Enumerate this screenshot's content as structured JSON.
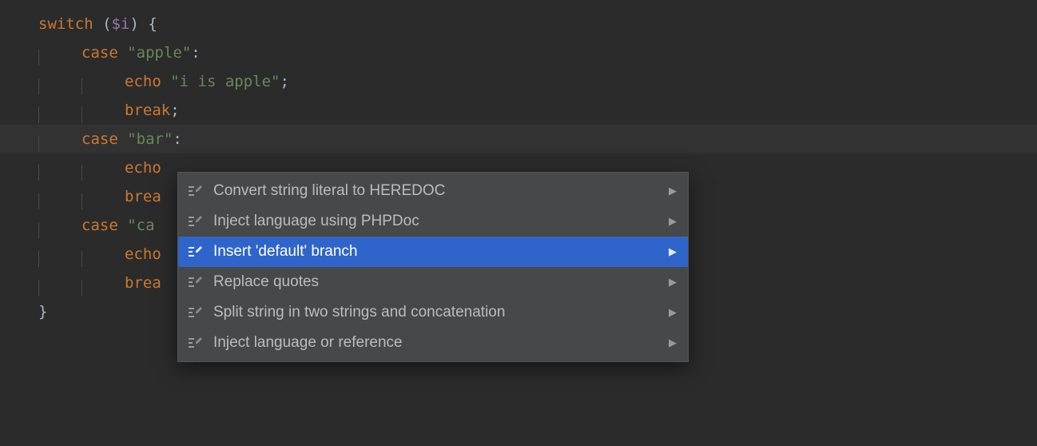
{
  "code": {
    "lines": [
      {
        "indent": 0,
        "highlighted": false,
        "tokens": [
          {
            "cls": "tok-keyword",
            "t": "switch"
          },
          {
            "cls": "tok-plain",
            "t": " "
          },
          {
            "cls": "tok-punct",
            "t": "("
          },
          {
            "cls": "tok-var",
            "t": "$i"
          },
          {
            "cls": "tok-punct",
            "t": ") {"
          }
        ]
      },
      {
        "indent": 1,
        "highlighted": false,
        "tokens": [
          {
            "cls": "tok-keyword",
            "t": "case"
          },
          {
            "cls": "tok-plain",
            "t": " "
          },
          {
            "cls": "tok-string",
            "t": "\"apple\""
          },
          {
            "cls": "tok-punct",
            "t": ":"
          }
        ]
      },
      {
        "indent": 2,
        "highlighted": false,
        "tokens": [
          {
            "cls": "tok-keyword",
            "t": "echo"
          },
          {
            "cls": "tok-plain",
            "t": " "
          },
          {
            "cls": "tok-string",
            "t": "\"i is apple\""
          },
          {
            "cls": "tok-punct",
            "t": ";"
          }
        ]
      },
      {
        "indent": 2,
        "highlighted": false,
        "tokens": [
          {
            "cls": "tok-keyword",
            "t": "break"
          },
          {
            "cls": "tok-punct",
            "t": ";"
          }
        ]
      },
      {
        "indent": 1,
        "highlighted": true,
        "tokens": [
          {
            "cls": "tok-keyword",
            "t": "case"
          },
          {
            "cls": "tok-plain",
            "t": " "
          },
          {
            "cls": "tok-string",
            "t": "\"bar\""
          },
          {
            "cls": "tok-punct",
            "t": ":"
          }
        ]
      },
      {
        "indent": 2,
        "highlighted": false,
        "tokens": [
          {
            "cls": "tok-keyword",
            "t": "echo"
          }
        ]
      },
      {
        "indent": 2,
        "highlighted": false,
        "tokens": [
          {
            "cls": "tok-keyword",
            "t": "brea"
          }
        ]
      },
      {
        "indent": 1,
        "highlighted": false,
        "tokens": [
          {
            "cls": "tok-keyword",
            "t": "case"
          },
          {
            "cls": "tok-plain",
            "t": " "
          },
          {
            "cls": "tok-string",
            "t": "\"ca"
          }
        ]
      },
      {
        "indent": 2,
        "highlighted": false,
        "tokens": [
          {
            "cls": "tok-keyword",
            "t": "echo"
          }
        ]
      },
      {
        "indent": 2,
        "highlighted": false,
        "tokens": [
          {
            "cls": "tok-keyword",
            "t": "brea"
          }
        ]
      },
      {
        "indent": 0,
        "highlighted": false,
        "tokens": [
          {
            "cls": "tok-punct",
            "t": "}"
          }
        ]
      }
    ]
  },
  "popup": {
    "items": [
      {
        "label": "Convert string literal to HEREDOC",
        "selected": false,
        "submenu": true
      },
      {
        "label": "Inject language using PHPDoc",
        "selected": false,
        "submenu": true
      },
      {
        "label": "Insert 'default' branch",
        "selected": true,
        "submenu": true
      },
      {
        "label": "Replace quotes",
        "selected": false,
        "submenu": true
      },
      {
        "label": "Split string in two strings and concatenation",
        "selected": false,
        "submenu": true
      },
      {
        "label": "Inject language or reference",
        "selected": false,
        "submenu": true
      }
    ]
  },
  "colors": {
    "background": "#2b2b2b",
    "highlight_line": "#323232",
    "popup_bg": "#46484a",
    "popup_selected": "#2f65ca"
  }
}
